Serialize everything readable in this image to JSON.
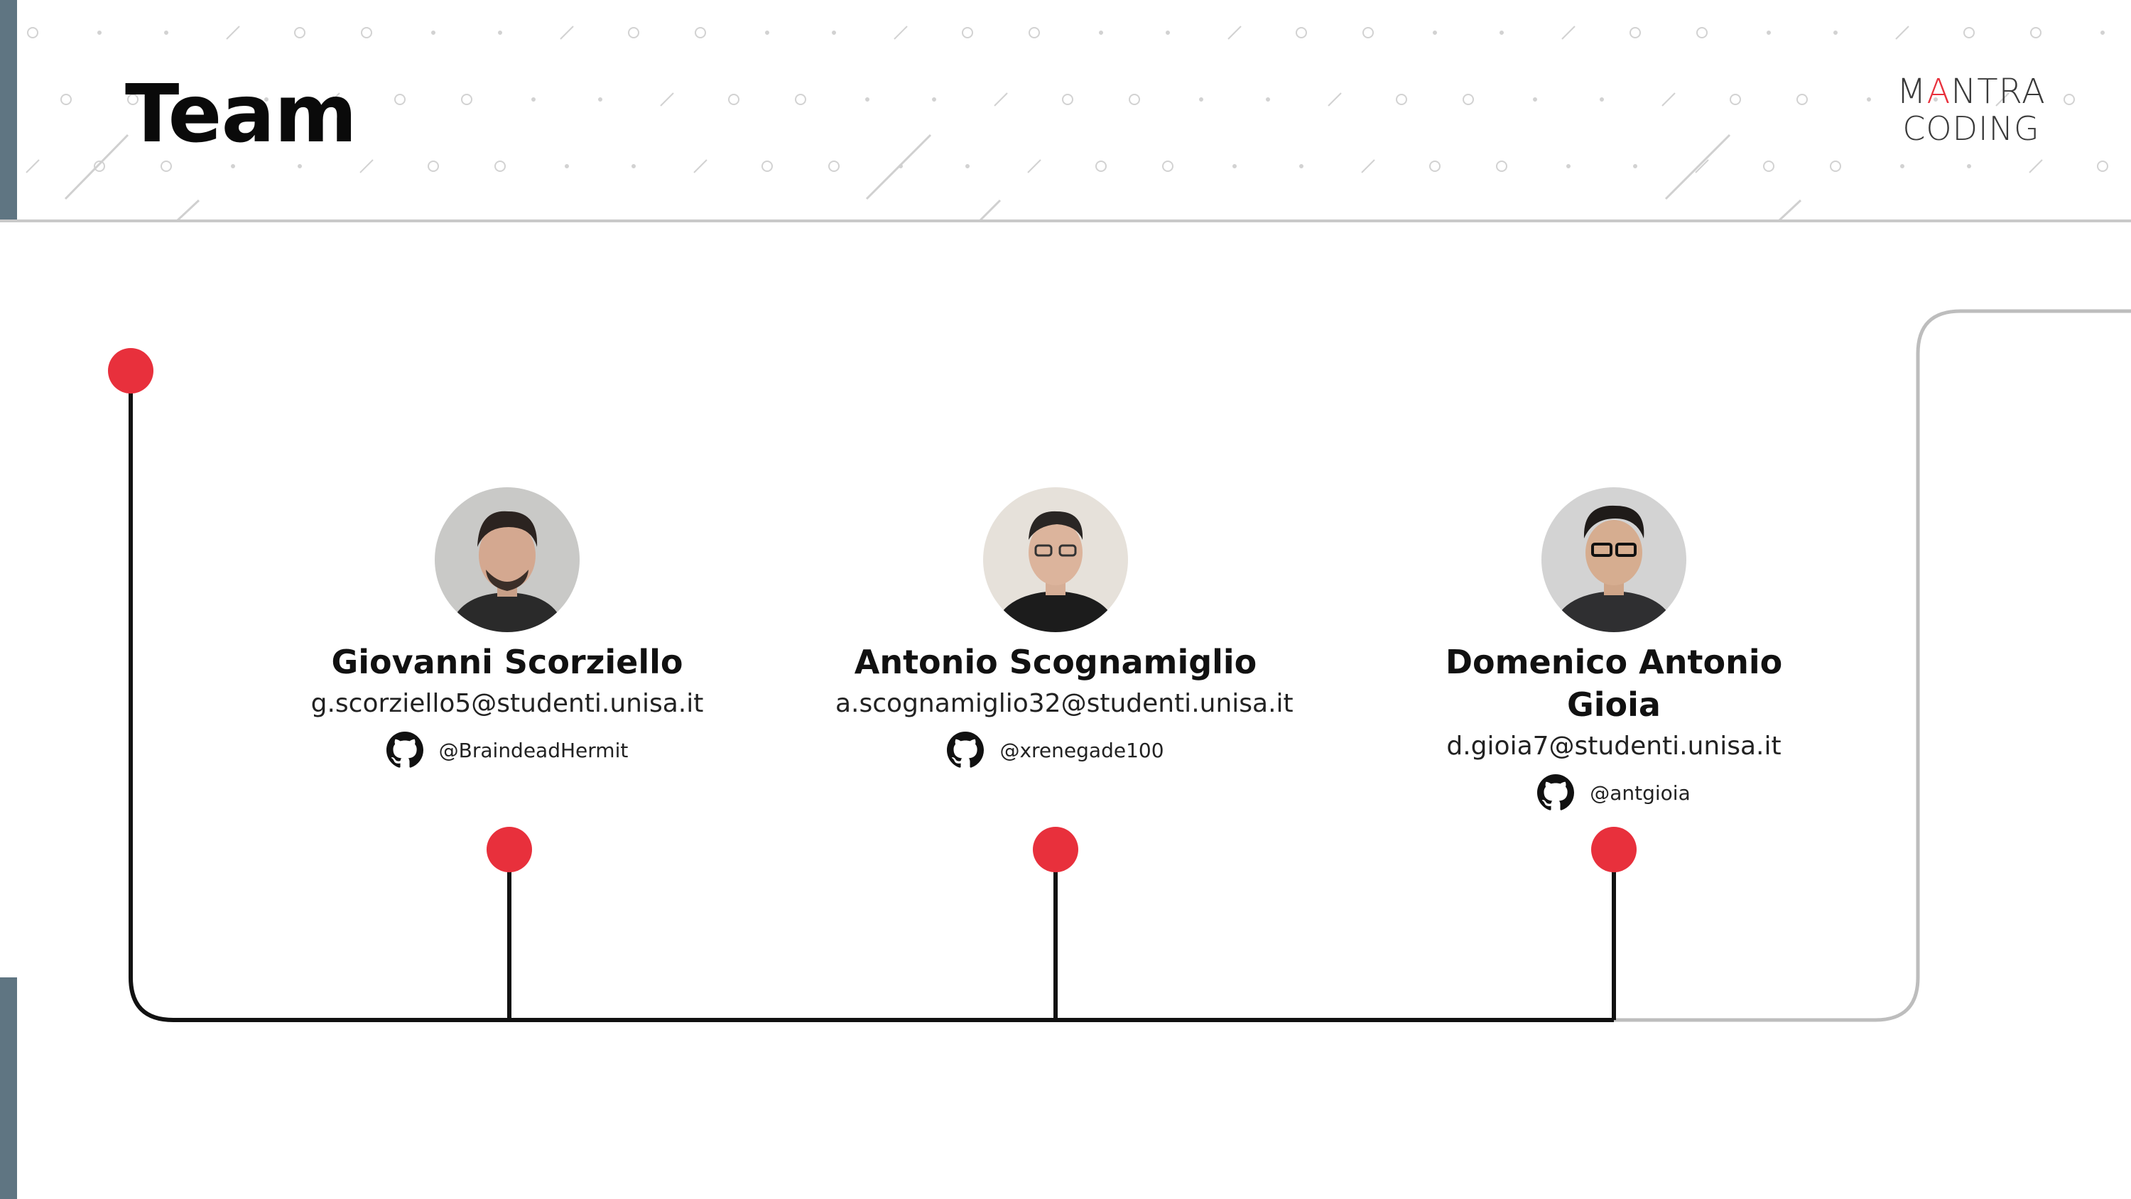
{
  "slide": {
    "title": "Team",
    "logo": {
      "line1_part1": "M",
      "line1_accent": "A",
      "line1_part2": "NTRA",
      "line2": "CODING"
    }
  },
  "colors": {
    "accent": "#e8303c",
    "sidebar": "#5f7582",
    "line": "#111111",
    "frame": "#bdbdbd"
  },
  "members": [
    {
      "name": "Giovanni Scorziello",
      "email": "g.scorziello5@studenti.unisa.it",
      "github_icon": "github-icon",
      "github": "@BraindeadHermit"
    },
    {
      "name": "Antonio Scognamiglio",
      "email": "a.scognamiglio32@studenti.unisa.it",
      "github_icon": "github-icon",
      "github": "@xrenegade100"
    },
    {
      "name": "Domenico Antonio Gioia",
      "email": "d.gioia7@studenti.unisa.it",
      "github_icon": "github-icon",
      "github": "@antgioia"
    }
  ]
}
